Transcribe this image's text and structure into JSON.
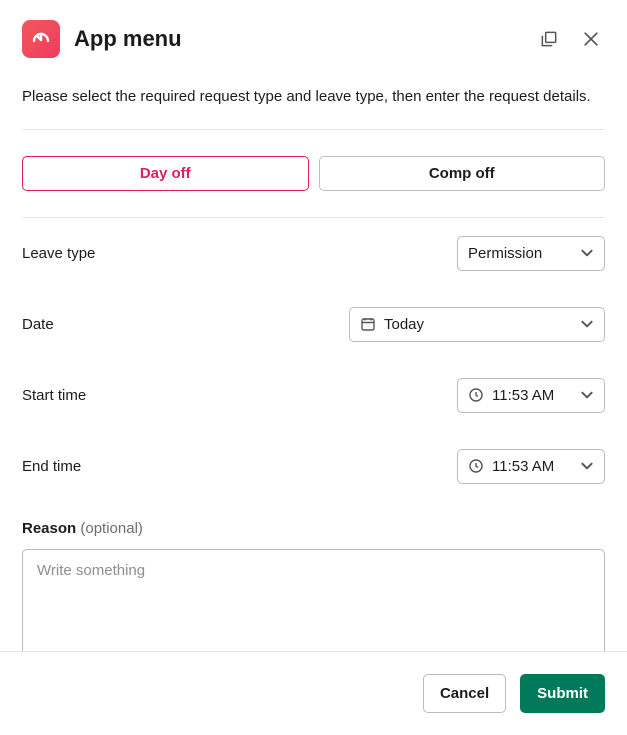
{
  "header": {
    "title": "App menu"
  },
  "intro": "Please select the required request type and leave type, then enter the request details.",
  "tabs": {
    "day_off": "Day off",
    "comp_off": "Comp off"
  },
  "fields": {
    "leave_type": {
      "label": "Leave type",
      "value": "Permission"
    },
    "date": {
      "label": "Date",
      "value": "Today"
    },
    "start_time": {
      "label": "Start time",
      "value": "11:53 AM"
    },
    "end_time": {
      "label": "End time",
      "value": "11:53 AM"
    },
    "reason": {
      "label": "Reason",
      "optional_text": "(optional)",
      "placeholder": "Write something"
    }
  },
  "footer": {
    "cancel": "Cancel",
    "submit": "Submit"
  }
}
